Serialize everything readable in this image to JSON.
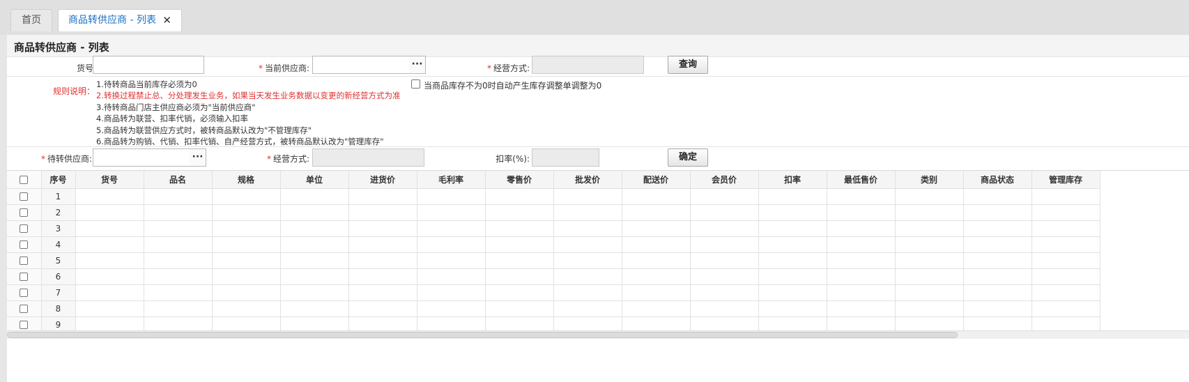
{
  "tabs": {
    "home_label": "首页",
    "active_label": "商品转供应商 - 列表",
    "close_glyph": "✕"
  },
  "page_title": "商品转供应商 - 列表",
  "search": {
    "item_no_label": "货号:",
    "item_no_value": "",
    "current_supplier_label": "当前供应商:",
    "current_supplier_value": "",
    "business_mode_label": "经营方式:",
    "business_mode_value": "",
    "query_button": "查询",
    "required_mark": "*",
    "ellipsis": "···"
  },
  "rules": {
    "label": "规则说明：",
    "items": [
      {
        "text": "1.待转商品当前库存必须为0",
        "red": false
      },
      {
        "text": "2.转换过程禁止总、分处理发生业务，如果当天发生业务数据以变更的新经营方式为准",
        "red": true
      },
      {
        "text": "3.待转商品门店主供应商必须为\"当前供应商\"",
        "red": false
      },
      {
        "text": "4.商品转为联营、扣率代销，必须输入扣率",
        "red": false
      },
      {
        "text": "5.商品转为联营供应方式时，被转商品默认改为\"不管理库存\"",
        "red": false
      },
      {
        "text": "6.商品转为购销、代销、扣率代销、自产经营方式，被转商品默认改为\"管理库存\"",
        "red": false
      }
    ],
    "auto_adjust_label": "当商品库存不为0时自动产生库存调整单调整为0"
  },
  "target": {
    "target_supplier_label": "待转供应商:",
    "target_supplier_value": "",
    "business_mode_label": "经营方式:",
    "business_mode_value": "",
    "discount_label": "扣率(%):",
    "discount_value": "",
    "confirm_button": "确定"
  },
  "grid": {
    "columns": [
      "序号",
      "货号",
      "品名",
      "规格",
      "单位",
      "进货价",
      "毛利率",
      "零售价",
      "批发价",
      "配送价",
      "会员价",
      "扣率",
      "最低售价",
      "类别",
      "商品状态",
      "管理库存"
    ],
    "rows": [
      "1",
      "2",
      "3",
      "4",
      "5",
      "6",
      "7",
      "8",
      "9"
    ]
  }
}
